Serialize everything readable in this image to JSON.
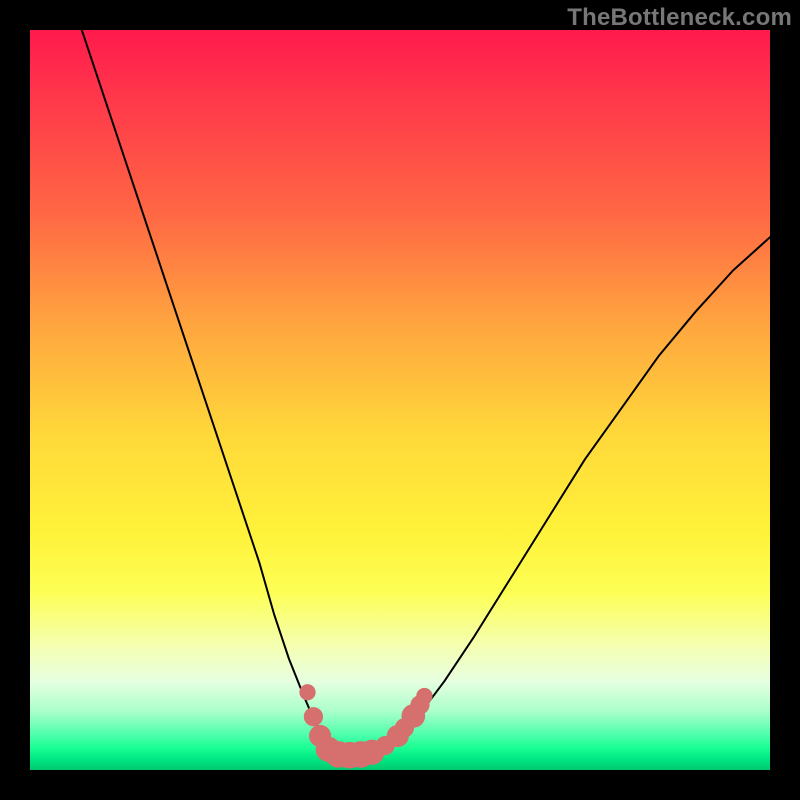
{
  "watermark": "TheBottleneck.com",
  "chart_data": {
    "type": "line",
    "title": "",
    "xlabel": "",
    "ylabel": "",
    "xlim": [
      0,
      100
    ],
    "ylim": [
      0,
      100
    ],
    "grid": false,
    "legend": false,
    "series": [
      {
        "name": "bottleneck-curve",
        "x": [
          7,
          10,
          13,
          16,
          19,
          22,
          25,
          28,
          31,
          33,
          35,
          37,
          38.5,
          40,
          41.5,
          43,
          45,
          47,
          50,
          53,
          56,
          60,
          65,
          70,
          75,
          80,
          85,
          90,
          95,
          100
        ],
        "values": [
          100,
          91,
          82,
          73,
          64,
          55,
          46,
          37,
          28,
          21,
          15,
          10,
          6.5,
          4,
          2.5,
          2,
          2,
          2.5,
          4.5,
          8,
          12,
          18,
          26,
          34,
          42,
          49,
          56,
          62,
          67.5,
          72
        ]
      }
    ],
    "markers": {
      "name": "highlight-dots",
      "color": "#d6706f",
      "points": [
        {
          "x": 37.5,
          "y": 10.5,
          "r": 1.1
        },
        {
          "x": 38.3,
          "y": 7.2,
          "r": 1.3
        },
        {
          "x": 39.2,
          "y": 4.6,
          "r": 1.5
        },
        {
          "x": 40.3,
          "y": 2.8,
          "r": 1.7
        },
        {
          "x": 41.7,
          "y": 2.1,
          "r": 1.8
        },
        {
          "x": 43.2,
          "y": 2.0,
          "r": 1.8
        },
        {
          "x": 44.7,
          "y": 2.1,
          "r": 1.8
        },
        {
          "x": 46.2,
          "y": 2.4,
          "r": 1.7
        },
        {
          "x": 48.0,
          "y": 3.3,
          "r": 1.3
        },
        {
          "x": 49.7,
          "y": 4.6,
          "r": 1.5
        },
        {
          "x": 50.6,
          "y": 5.7,
          "r": 1.3
        },
        {
          "x": 51.8,
          "y": 7.3,
          "r": 1.6
        },
        {
          "x": 52.7,
          "y": 8.8,
          "r": 1.3
        },
        {
          "x": 53.3,
          "y": 10.0,
          "r": 1.1
        }
      ]
    }
  }
}
